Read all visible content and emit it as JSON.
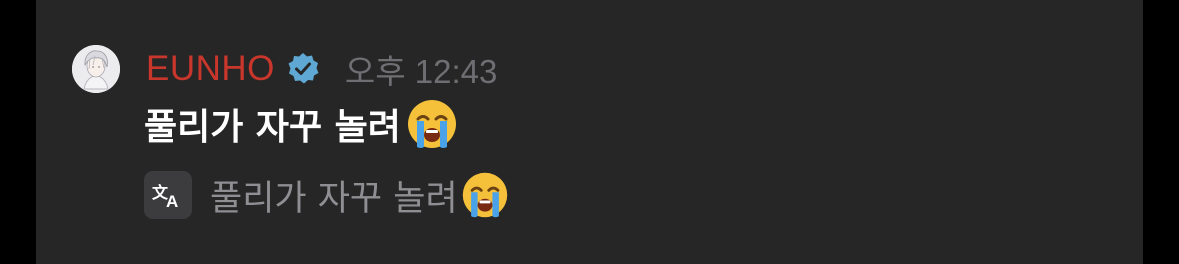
{
  "message": {
    "author": {
      "name": "EUNHO",
      "name_color": "#c9362b",
      "verified": true,
      "verified_icon": "verified-badge-icon",
      "avatar_icon": "avatar-anime-portrait"
    },
    "timestamp": "오후 12:43",
    "text": "풀리가 자꾸 놀려",
    "emoji": "loudly-crying-face",
    "translation": {
      "icon": "translate-icon",
      "text": "풀리가 자꾸 놀려",
      "emoji": "loudly-crying-face"
    }
  },
  "colors": {
    "panel_bg": "#262626",
    "outer_bg": "#000000",
    "verified_blue": "#5fa8d3",
    "timestamp": "#6f6f73",
    "translation_text": "#8e8e93"
  }
}
